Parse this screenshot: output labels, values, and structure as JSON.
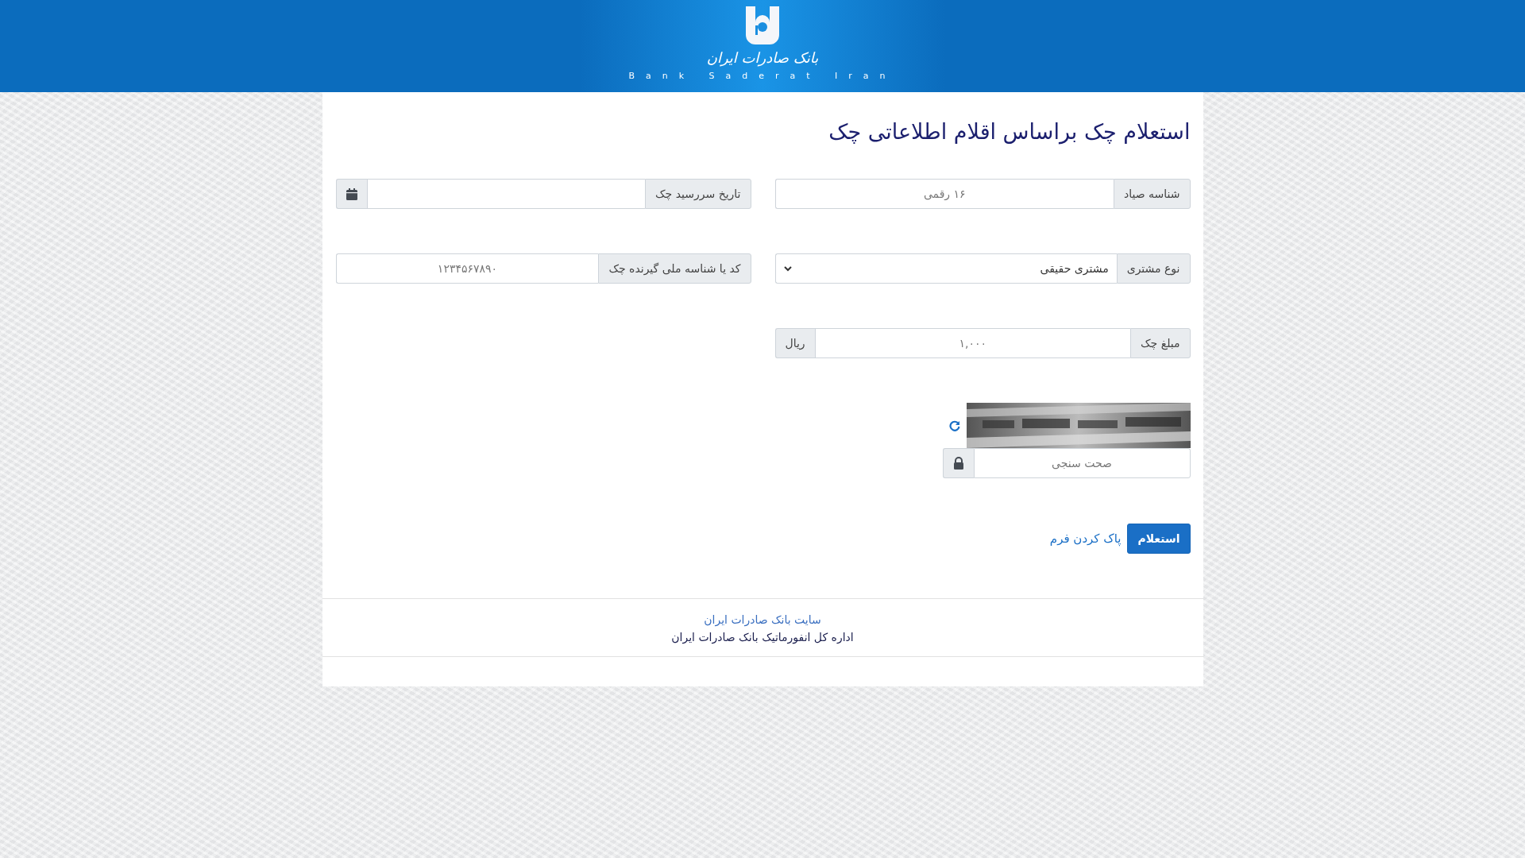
{
  "header": {
    "logo_text": "بانک صادرات ایران",
    "logo_subtitle": "Bank Saderat Iran"
  },
  "title": "استعلام چک براساس اقلام اطلاعاتی چک",
  "fields": [
    {
      "kind": "text",
      "label": "شناسه صیاد",
      "placeholder": "۱۶ رقمی"
    },
    {
      "kind": "date",
      "label": "تاریخ سررسید چک"
    },
    {
      "kind": "select",
      "label": "نوع مشتری",
      "value": "مشتری حقیقی"
    },
    {
      "kind": "text",
      "label": "کد یا شناسه ملی گیرنده چک",
      "placeholder": "۱۲۳۴۵۶۷۸۹۰"
    },
    {
      "kind": "amount",
      "label": "مبلغ چک",
      "placeholder": "۱,۰۰۰",
      "unit": "ریال"
    }
  ],
  "captcha": {
    "placeholder": "صحت سنجی"
  },
  "buttons": {
    "submit": "استعلام",
    "reset": "پاک کردن فرم"
  },
  "footer": {
    "link": "سایت بانک صادرات ایران",
    "text": "اداره کل انفورماتیک بانک صادرات ایران"
  }
}
